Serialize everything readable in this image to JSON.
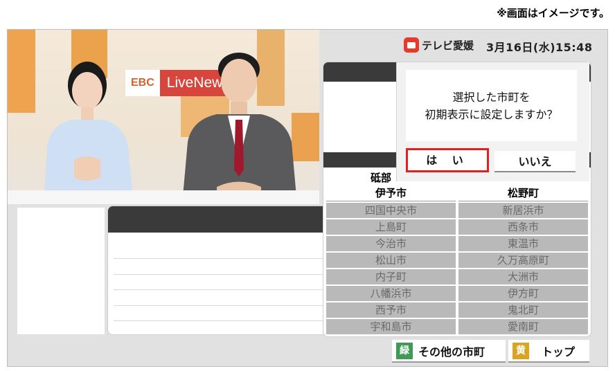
{
  "note": "※画面はイメージです。",
  "header": {
    "logo_text": "テレビ愛媛",
    "datetime": "3月16日(水)15:48"
  },
  "video": {
    "ebc_label": "EBC",
    "livenews_label": "LiveNews"
  },
  "dialog": {
    "message_line1": "選択した市町を",
    "message_line2": "初期表示に設定しますか？",
    "yes_label": "は い",
    "no_label": "いいえ"
  },
  "city_list": {
    "partial_label": "砥部",
    "selected": [
      "伊予市",
      "松野町"
    ],
    "cities": [
      [
        "四国中央市",
        "新居浜市"
      ],
      [
        "上島町",
        "西条市"
      ],
      [
        "今治市",
        "東温市"
      ],
      [
        "松山市",
        "久万高原町"
      ],
      [
        "内子町",
        "大洲市"
      ],
      [
        "八幡浜市",
        "伊方町"
      ],
      [
        "西予市",
        "鬼北町"
      ],
      [
        "宇和島市",
        "愛南町"
      ]
    ]
  },
  "bottom": {
    "green_key": "緑",
    "green_label": "その他の市町",
    "yellow_key": "黄",
    "yellow_label": "トップ"
  },
  "colors": {
    "accent_red": "#e02020",
    "green_key": "#3f9a57",
    "yellow_key": "#d9a521",
    "header_dark": "#3a3a3a"
  }
}
